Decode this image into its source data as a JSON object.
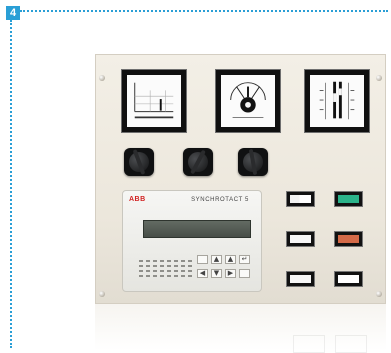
{
  "figure_label": "4",
  "colors": {
    "label_blue": "#2a9fd6",
    "panel": "#eee9df",
    "button_green": "#2bb38a",
    "button_orange": "#d46a48"
  },
  "synchronizer": {
    "brand": "ABB",
    "model": "SYNCHROTACT 5"
  }
}
